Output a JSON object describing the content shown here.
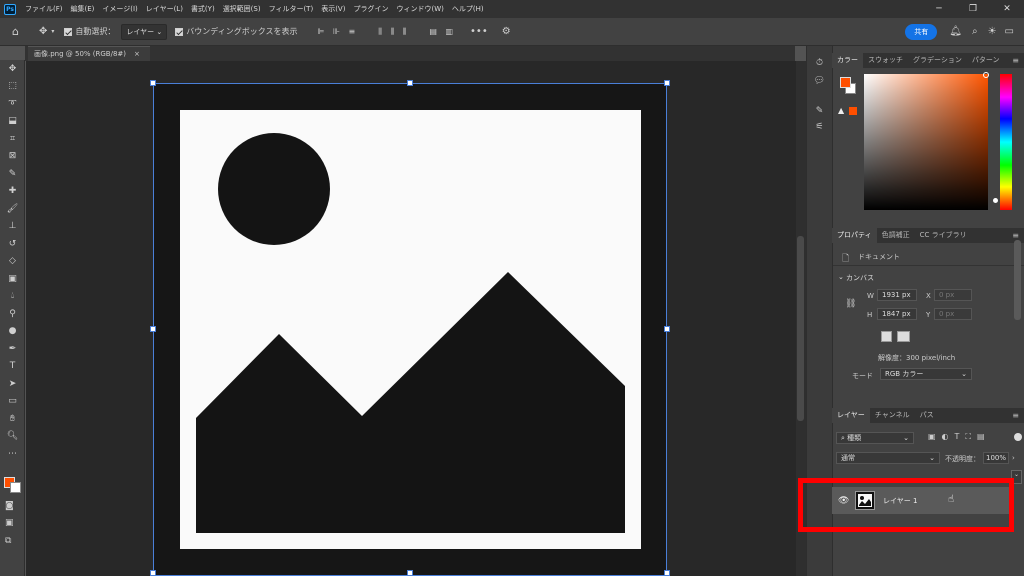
{
  "app_logo": "Ps",
  "menu": [
    "ファイル(F)",
    "編集(E)",
    "イメージ(I)",
    "レイヤー(L)",
    "書式(Y)",
    "選択範囲(S)",
    "フィルター(T)",
    "表示(V)",
    "プラグイン",
    "ウィンドウ(W)",
    "ヘルプ(H)"
  ],
  "options": {
    "auto_select_label": "自動選択：",
    "auto_select_value": "レイヤー",
    "bounding_box_label": "バウンディングボックスを表示",
    "share_label": "共有"
  },
  "document": {
    "tab_title": "画像.png @ 50% (RGB/8#)",
    "tab_close": "×"
  },
  "color_panel": {
    "tabs": [
      "カラー",
      "スウォッチ",
      "グラデーション",
      "パターン"
    ],
    "foreground": "#ff4f00",
    "background": "#ffffff"
  },
  "properties_panel": {
    "tabs": [
      "プロパティ",
      "色調補正",
      "CC ライブラリ"
    ],
    "doc_label": "ドキュメント",
    "canvas_label": "カンバス",
    "w_label": "W",
    "w_value": "1931 px",
    "h_label": "H",
    "h_value": "1847 px",
    "x_label": "X",
    "x_value": "0 px",
    "y_label": "Y",
    "y_value": "0 px",
    "resolution": "解像度：300 pixel/inch",
    "mode_label": "モード",
    "mode_value": "RGB カラー"
  },
  "layers_panel": {
    "tabs": [
      "レイヤー",
      "チャンネル",
      "パス"
    ],
    "filter_value": "種類",
    "blend_mode": "通常",
    "opacity_label": "不透明度：",
    "opacity_value": "100%",
    "layer_name": "レイヤー 1"
  },
  "colors": {
    "highlight": "#ff0000",
    "selection_box": "#4a7fd8",
    "share_button": "#1473e6"
  }
}
